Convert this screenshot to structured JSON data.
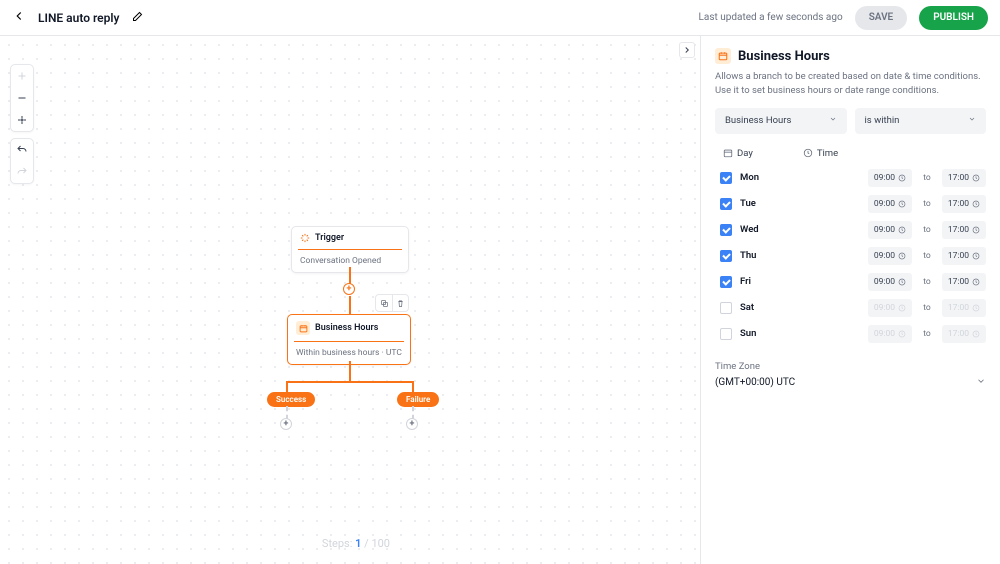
{
  "topbar": {
    "title": "LINE auto reply",
    "last_updated": "Last updated a few seconds ago",
    "save_label": "SAVE",
    "publish_label": "PUBLISH"
  },
  "flow": {
    "trigger": {
      "title": "Trigger",
      "body": "Conversation Opened"
    },
    "business": {
      "title": "Business Hours",
      "body": "Within business hours · UTC"
    },
    "branch_success": "Success",
    "branch_failure": "Failure",
    "steps_label": "Steps:",
    "steps_current": "1",
    "steps_total": "/ 100"
  },
  "panel": {
    "title": "Business Hours",
    "description": "Allows a branch to be created based on date & time conditions. Use it to set business hours or date range conditions.",
    "select1": "Business Hours",
    "select2": "is within",
    "col_day": "Day",
    "col_time": "Time",
    "to": "to",
    "timezone_label": "Time Zone",
    "timezone_value": "(GMT+00:00) UTC",
    "days": [
      {
        "label": "Mon",
        "checked": true,
        "start": "09:00",
        "end": "17:00"
      },
      {
        "label": "Tue",
        "checked": true,
        "start": "09:00",
        "end": "17:00"
      },
      {
        "label": "Wed",
        "checked": true,
        "start": "09:00",
        "end": "17:00"
      },
      {
        "label": "Thu",
        "checked": true,
        "start": "09:00",
        "end": "17:00"
      },
      {
        "label": "Fri",
        "checked": true,
        "start": "09:00",
        "end": "17:00"
      },
      {
        "label": "Sat",
        "checked": false,
        "start": "09:00",
        "end": "17:00"
      },
      {
        "label": "Sun",
        "checked": false,
        "start": "09:00",
        "end": "17:00"
      }
    ]
  }
}
